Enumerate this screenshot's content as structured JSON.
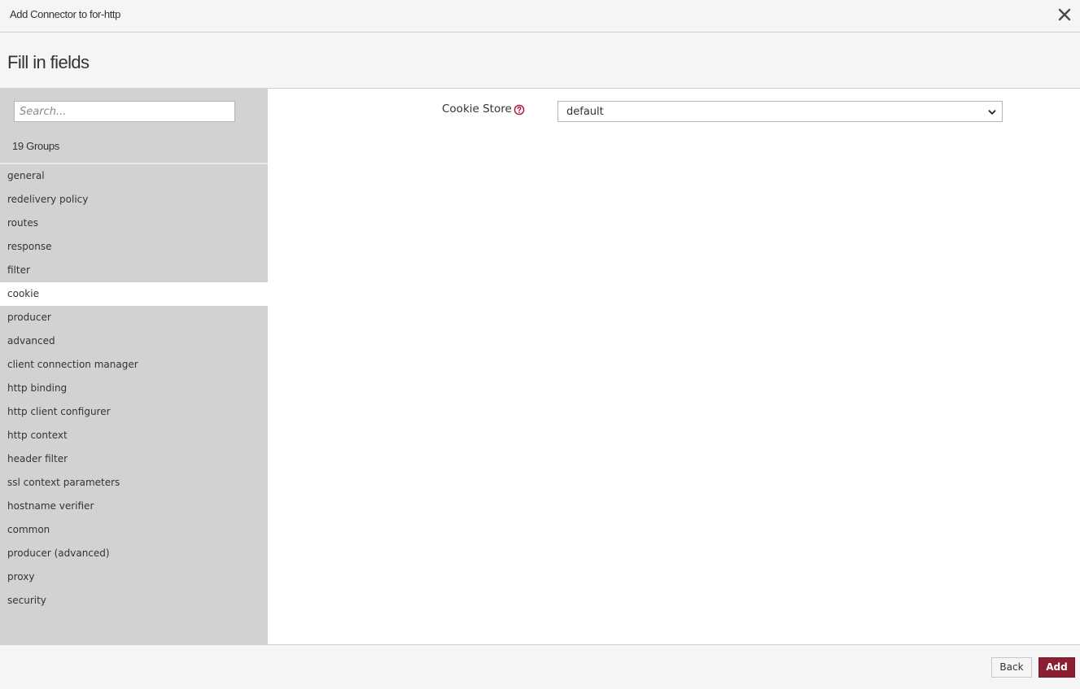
{
  "dialog": {
    "title": "Add Connector to for-http",
    "close_icon": "close-icon"
  },
  "subheader": {
    "title": "Fill in fields"
  },
  "sidebar": {
    "search_placeholder": "Search...",
    "groups_count": "19 Groups",
    "items": [
      {
        "label": "general"
      },
      {
        "label": "redelivery policy"
      },
      {
        "label": "routes"
      },
      {
        "label": "response"
      },
      {
        "label": "filter"
      },
      {
        "label": "cookie",
        "active": true
      },
      {
        "label": "producer"
      },
      {
        "label": "advanced"
      },
      {
        "label": "client connection manager"
      },
      {
        "label": "http binding"
      },
      {
        "label": "http client configurer"
      },
      {
        "label": "http context"
      },
      {
        "label": "header filter"
      },
      {
        "label": "ssl context parameters"
      },
      {
        "label": "hostname verifier"
      },
      {
        "label": "common"
      },
      {
        "label": "producer (advanced)"
      },
      {
        "label": "proxy"
      },
      {
        "label": "security"
      }
    ]
  },
  "form": {
    "fields": [
      {
        "label": "Cookie Store",
        "value": "default",
        "help_icon": "help-circle-icon"
      }
    ]
  },
  "footer": {
    "back_label": "Back",
    "add_label": "Add"
  },
  "colors": {
    "accent": "#8a1e33",
    "sidebar_bg": "#d2d2d2",
    "active_item_bg": "#ffffff",
    "help_icon": "#b0103a"
  }
}
